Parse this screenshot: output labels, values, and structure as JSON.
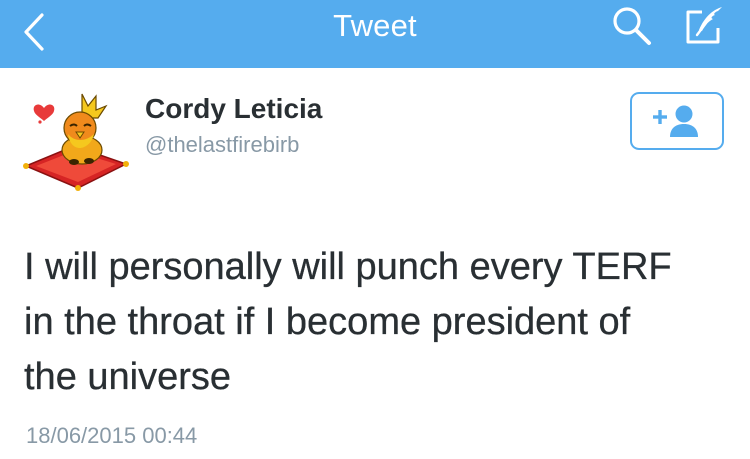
{
  "nav": {
    "title": "Tweet",
    "back_icon": "chevron-left-icon",
    "search_icon": "search-icon",
    "compose_icon": "compose-icon",
    "background": "#55acee"
  },
  "tweet": {
    "author": {
      "display_name": "Cordy Leticia",
      "handle": "@thelastfirebirb",
      "avatar_icon": "avatar-fire-chick-icon"
    },
    "follow_button_icon": "follow-user-icon",
    "text_lines": [
      "I will personally will punch every TERF",
      "in the throat if I become president of",
      "the universe"
    ],
    "timestamp": "18/06/2015 00:44"
  },
  "colors": {
    "accent": "#55acee",
    "text": "#292f33",
    "muted": "#8899a6"
  }
}
